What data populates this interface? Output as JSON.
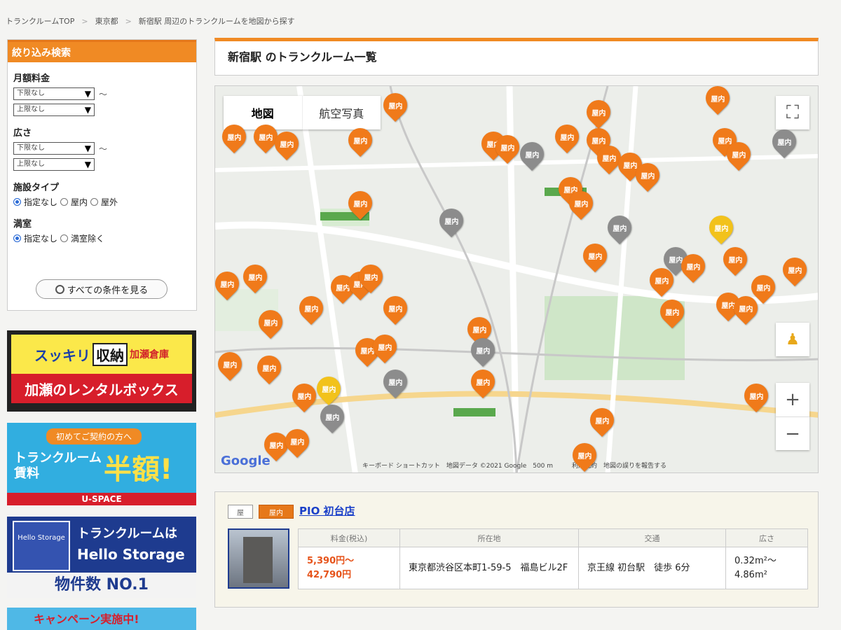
{
  "breadcrumb": [
    "トランクルームTOP",
    "東京都",
    "新宿駅 周辺のトランクルームを地図から探す"
  ],
  "sidebar": {
    "title": "絞り込み検索",
    "rent_label": "月額料金",
    "rent_min": "下限なし",
    "rent_max": "上限なし",
    "tilde": "〜",
    "size_label": "広さ",
    "size_min": "下限なし",
    "size_max": "上限なし",
    "type_label": "施設タイプ",
    "type_options": [
      "指定なし",
      "屋内",
      "屋外"
    ],
    "full_label": "満室",
    "full_options": [
      "指定なし",
      "満室除く"
    ],
    "all_button": "すべての条件を見る"
  },
  "ads": {
    "ad1_brand_a": "スッキリ",
    "ad1_box": "収納",
    "ad1_small": "加瀬倉庫",
    "ad1_bottom": "加瀬のレンタルボックス",
    "ad2_pill": "初めてご契約の方へ",
    "ad2_main": "トランクルーム賃料",
    "ad2_half": "半額!",
    "ad2_brand": "U-SPACE",
    "ad3_logo": "Hello Storage",
    "ad3_t1": "トランクルームは",
    "ad3_t2": "Hello Storage",
    "ad3_t3": "物件数 NO.1",
    "ad4": "キャンペーン実施中!"
  },
  "main": {
    "title": "新宿駅 のトランクルーム一覧",
    "map_tab_map": "地図",
    "map_tab_sat": "航空写真",
    "pin_label": "屋内",
    "zoom_in": "+",
    "zoom_out": "−",
    "google": "Google",
    "map_footer": "キーボード ショートカット　地図データ ©2021 Google　500 m　　　利用規約　地図の誤りを報告する"
  },
  "listing": {
    "tag_outdoor": "屋",
    "tag_indoor": "屋内",
    "store_name": "PIO 初台店",
    "headers": [
      "料金(税込)",
      "所在地",
      "交通",
      "広さ"
    ],
    "price": "5,390円〜\n42,790円",
    "address": "東京都渋谷区本町1-59-5　福島ビル2F",
    "access": "京王線 初台駅　徒歩 6分",
    "size": "0.32m²〜\n4.86m²"
  },
  "colors": {
    "accent": "#f08a24",
    "pin_orange": "#f07a1a",
    "pin_gray": "#8c8c8c",
    "pin_yellow": "#f2c21b"
  }
}
